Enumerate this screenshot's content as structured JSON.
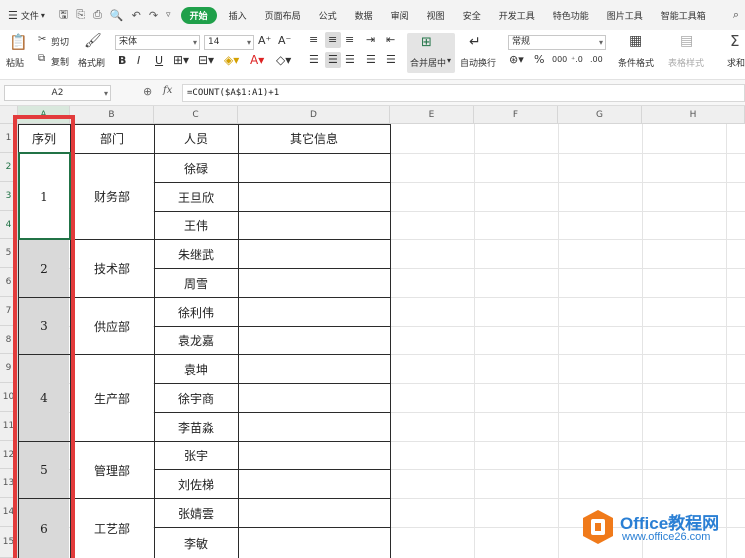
{
  "menu": {
    "file_label": "文件",
    "start_tab": "开始",
    "tabs": [
      "插入",
      "页面布局",
      "公式",
      "数据",
      "审阅",
      "视图",
      "安全",
      "开发工具",
      "特色功能",
      "图片工具",
      "智能工具箱"
    ]
  },
  "ribbon": {
    "paste": "粘贴",
    "cut": "剪切",
    "copy": "复制",
    "format_painter": "格式刷",
    "font_name": "宋体",
    "font_size": "14",
    "merge_center": "合并居中",
    "wrap_text": "自动换行",
    "number_format": "常规",
    "conditional_format": "条件格式",
    "table_style": "表格样式",
    "sum": "求和"
  },
  "formula_bar": {
    "name_box": "A2",
    "formula": "=COUNT($A$1:A1)+1"
  },
  "columns": [
    "A",
    "B",
    "C",
    "D",
    "E",
    "F",
    "G",
    "H"
  ],
  "rows": [
    "1",
    "2",
    "3",
    "4",
    "5",
    "6",
    "7",
    "8",
    "9",
    "10",
    "11",
    "12",
    "13",
    "14",
    "15"
  ],
  "headers": {
    "seq": "序列",
    "dept": "部门",
    "person": "人员",
    "other": "其它信息"
  },
  "groups": [
    {
      "seq": "1",
      "dept": "财务部",
      "people": [
        "徐碌",
        "王旦欣",
        "王伟"
      ]
    },
    {
      "seq": "2",
      "dept": "技术部",
      "people": [
        "朱继武",
        "周雪"
      ]
    },
    {
      "seq": "3",
      "dept": "供应部",
      "people": [
        "徐利伟",
        "袁龙嘉"
      ]
    },
    {
      "seq": "4",
      "dept": "生产部",
      "people": [
        "袁坤",
        "徐宇商",
        "李苗淼"
      ]
    },
    {
      "seq": "5",
      "dept": "管理部",
      "people": [
        "张宇",
        "刘佐梯"
      ]
    },
    {
      "seq": "6",
      "dept": "工艺部",
      "people": [
        "张婧雲",
        "李敏"
      ]
    }
  ],
  "watermark": {
    "title": "Office教程网",
    "url": "www.office26.com"
  },
  "colors": {
    "accent_green": "#1fa04a",
    "highlight_red": "#e23b3b",
    "merged_shading": "#d9d9d9",
    "watermark_blue": "#2a7fd4",
    "watermark_orange": "#f07a1a"
  }
}
